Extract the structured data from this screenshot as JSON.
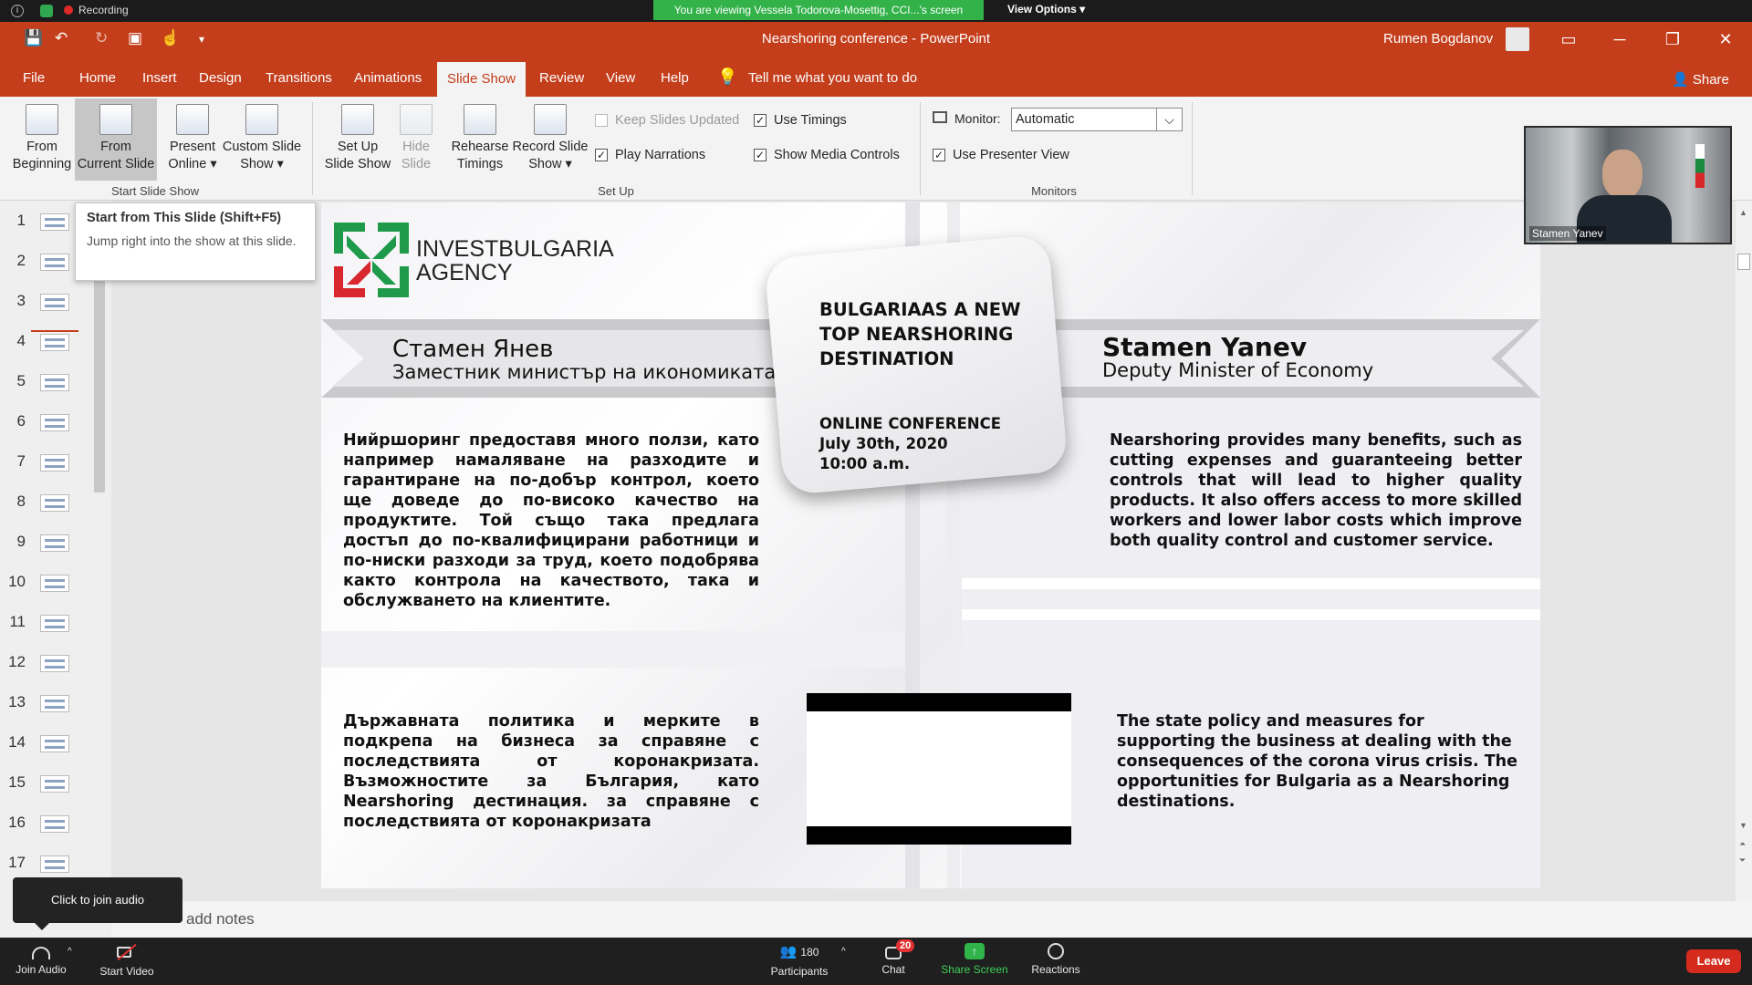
{
  "zoom": {
    "recording": "Recording",
    "viewing_banner": "You are viewing Vessela Todorova-Mosettig, CCI...'s screen",
    "view_options": "View Options",
    "bottom": {
      "join_audio": "Join Audio",
      "start_video": "Start Video",
      "participants": "Participants",
      "participants_count": "180",
      "chat": "Chat",
      "chat_badge": "20",
      "share_screen": "Share Screen",
      "reactions": "Reactions",
      "leave": "Leave"
    },
    "audio_tooltip": "Click to join audio",
    "video_name": "Stamen Yanev"
  },
  "powerpoint": {
    "title": "Nearshoring conference  -  PowerPoint",
    "user": "Rumen Bogdanov",
    "tabs": [
      "File",
      "Home",
      "Insert",
      "Design",
      "Transitions",
      "Animations",
      "Slide Show",
      "Review",
      "View",
      "Help"
    ],
    "active_tab": "Slide Show",
    "tell_me": "Tell me what you want to do",
    "share": "Share",
    "ribbon": {
      "from_beginning": [
        "From",
        "Beginning"
      ],
      "from_current": [
        "From",
        "Current Slide"
      ],
      "present_online": [
        "Present",
        "Online ▾"
      ],
      "custom_show": [
        "Custom Slide",
        "Show ▾"
      ],
      "group_start": "Start Slide Show",
      "setup_show": [
        "Set Up",
        "Slide Show"
      ],
      "hide_slide": [
        "Hide",
        "Slide"
      ],
      "rehearse": [
        "Rehearse",
        "Timings"
      ],
      "record": [
        "Record Slide",
        "Show ▾"
      ],
      "keep_updated": "Keep Slides Updated",
      "play_narrations": "Play Narrations",
      "use_timings": "Use Timings",
      "show_media_controls": "Show Media Controls",
      "group_setup": "Set Up",
      "monitor_label": "Monitor:",
      "monitor_value": "Automatic",
      "use_presenter_view": "Use Presenter View",
      "group_monitors": "Monitors"
    },
    "tooltip": {
      "title": "Start from This Slide (Shift+F5)",
      "desc": "Jump right into the show at this slide."
    },
    "slide_numbers": [
      "1",
      "2",
      "3",
      "4",
      "5",
      "6",
      "7",
      "8",
      "9",
      "10",
      "11",
      "12",
      "13",
      "14",
      "15",
      "16",
      "17",
      "1"
    ],
    "notes_placeholder": "add notes"
  },
  "slide": {
    "logo_line1": "INVESTBULGARIA",
    "logo_line2": "AGENCY",
    "name_bg": "Стамен Янев",
    "role_bg": "Заместник министър на икономиката",
    "name_en": "Stamen Yanev",
    "role_en": "Deputy Minister of Economy",
    "center_title": "BULGARIAAS A NEW TOP NEARSHORING DESTINATION",
    "center_sub1": "ONLINE CONFERENCE",
    "center_sub2": "July 30th, 2020",
    "center_sub3": "10:00 a.m.",
    "para1_bg": "Нийршоринг предоставя много ползи, като например намаляване на разходите и гарантиране на по-добър контрол, което ще доведе до по-високо качество на продуктите. Той също така предлага достъп до по-квалифицирани работници и по-ниски разходи за труд, което подобрява както контрола на качеството, така и обслужването на клиентите.",
    "para1_en": "Nearshoring provides many benefits, such as cutting expenses and guaranteeing better controls that will lead to higher quality products. It also offers access to more skilled workers and lower labor costs which improve both quality control and customer service.",
    "para2_bg": "Държавната политика и мерките в подкрепа на бизнеса за справяне с последствията от коронакризата. Възможностите за България, като Nearshoring дестинация. за справяне с последствията от коронакризата",
    "para2_en": "The state policy and measures for supporting the business at dealing with the consequences of the corona virus crisis. The opportunities for Bulgaria as a Nearshoring destinations."
  }
}
